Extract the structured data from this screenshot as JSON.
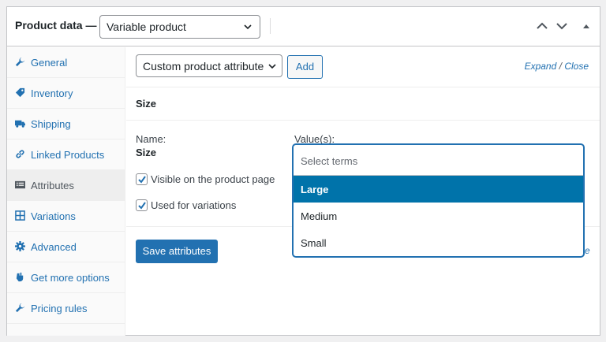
{
  "header": {
    "title": "Product data —",
    "product_type": "Variable product"
  },
  "sidebar": {
    "items": [
      {
        "label": "General",
        "icon": "wrench-icon"
      },
      {
        "label": "Inventory",
        "icon": "tag-icon"
      },
      {
        "label": "Shipping",
        "icon": "truck-icon"
      },
      {
        "label": "Linked Products",
        "icon": "link-icon"
      },
      {
        "label": "Attributes",
        "icon": "list-icon",
        "active": true
      },
      {
        "label": "Variations",
        "icon": "grid-icon"
      },
      {
        "label": "Advanced",
        "icon": "gear-icon"
      },
      {
        "label": "Get more options",
        "icon": "plugin-icon"
      },
      {
        "label": "Pricing rules",
        "icon": "wrench-icon"
      }
    ]
  },
  "toolbar": {
    "attribute_select": "Custom product attribute",
    "add_label": "Add",
    "expand_label": "Expand",
    "separator": "/",
    "close_label": "Close"
  },
  "attribute": {
    "heading": "Size",
    "name_label": "Name:",
    "name_value": "Size",
    "values_label": "Value(s):",
    "visible_label": "Visible on the product page",
    "visible_checked": true,
    "variations_label": "Used for variations",
    "variations_checked": true
  },
  "dropdown": {
    "placeholder": "Select terms",
    "options": [
      "Large",
      "Medium",
      "Small"
    ],
    "highlighted": "Large"
  },
  "footer": {
    "save_label": "Save attributes",
    "partial_text": "e"
  },
  "colors": {
    "accent": "#2271b1",
    "highlight": "#0073aa"
  }
}
